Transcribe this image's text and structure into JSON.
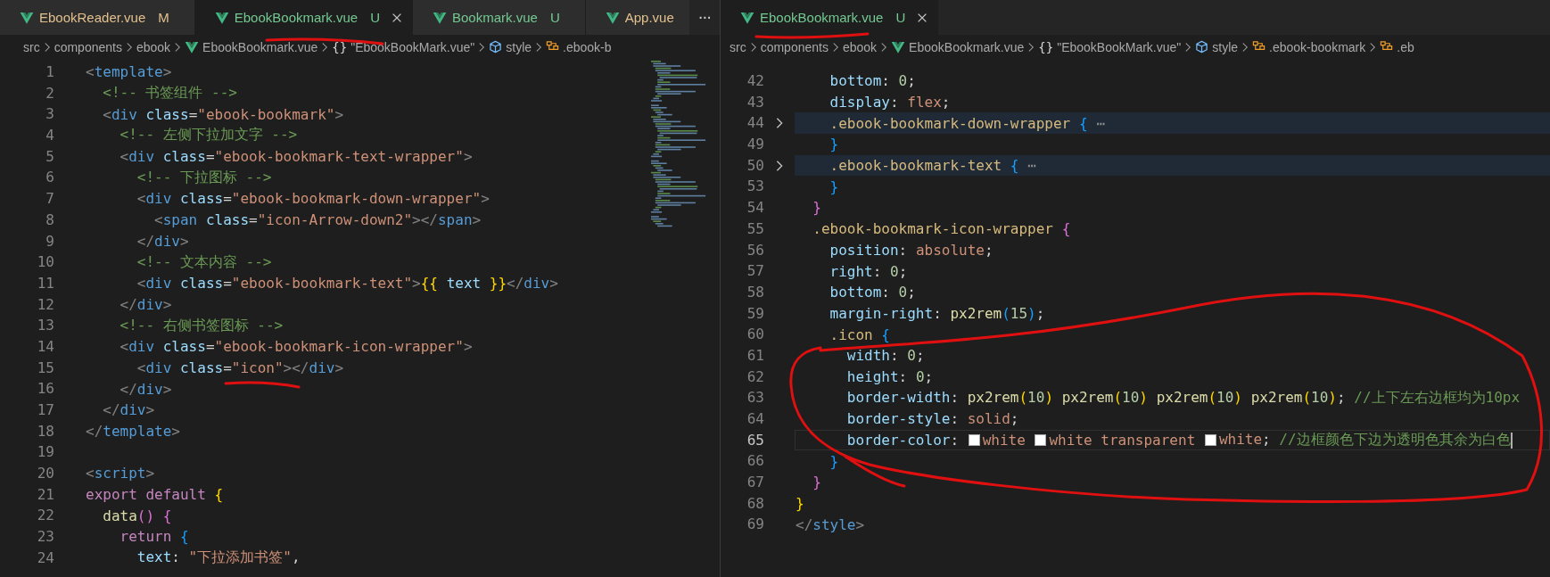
{
  "left_pane": {
    "tabs": [
      {
        "label": "EbookReader.vue",
        "badge": "M",
        "color": "#e2c08d",
        "selected": false
      },
      {
        "label": "EbookBookmark.vue",
        "badge": "U",
        "color": "#73c991",
        "selected": true
      },
      {
        "label": "Bookmark.vue",
        "badge": "U",
        "color": "#73c991",
        "selected": false
      },
      {
        "label": "App.vue",
        "color": "#e2c08d",
        "selected": false
      }
    ],
    "more": "···",
    "breadcrumbs": [
      {
        "kind": "folder",
        "label": "src"
      },
      {
        "kind": "folder",
        "label": "components"
      },
      {
        "kind": "folder",
        "label": "ebook"
      },
      {
        "kind": "file",
        "label": "EbookBookmark.vue"
      },
      {
        "kind": "object",
        "icon": "{}",
        "label": "\"EbookBookMark.vue\""
      },
      {
        "kind": "style",
        "label": "style"
      },
      {
        "kind": "selector",
        "label": ".ebook-b"
      }
    ],
    "lines": [
      {
        "number": "1",
        "text": "<template>"
      },
      {
        "number": "2",
        "text": "  <!-- 书签组件 -->"
      },
      {
        "number": "3",
        "text": "  <div class=\"ebook-bookmark\">"
      },
      {
        "number": "4",
        "text": "    <!-- 左侧下拉加文字 -->"
      },
      {
        "number": "5",
        "text": "    <div class=\"ebook-bookmark-text-wrapper\">"
      },
      {
        "number": "6",
        "text": "      <!-- 下拉图标 -->"
      },
      {
        "number": "7",
        "text": "      <div class=\"ebook-bookmark-down-wrapper\">"
      },
      {
        "number": "8",
        "text": "        <span class=\"icon-Arrow-down2\"></span>"
      },
      {
        "number": "9",
        "text": "      </div>"
      },
      {
        "number": "10",
        "text": "      <!-- 文本内容 -->"
      },
      {
        "number": "11",
        "text": "      <div class=\"ebook-bookmark-text\">{{ text }}</div>"
      },
      {
        "number": "12",
        "text": "    </div>"
      },
      {
        "number": "13",
        "text": "    <!-- 右侧书签图标 -->"
      },
      {
        "number": "14",
        "text": "    <div class=\"ebook-bookmark-icon-wrapper\">"
      },
      {
        "number": "15",
        "text": "      <div class=\"icon\"></div>"
      },
      {
        "number": "16",
        "text": "    </div>"
      },
      {
        "number": "17",
        "text": "  </div>"
      },
      {
        "number": "18",
        "text": "</template>"
      },
      {
        "number": "19"
      },
      {
        "number": "20",
        "text": "<script>"
      },
      {
        "number": "21",
        "text": "export default {"
      },
      {
        "number": "22",
        "text": "  data() {"
      },
      {
        "number": "23",
        "text": "    return {"
      },
      {
        "number": "24",
        "text": "      text: \"下拉添加书签\","
      }
    ]
  },
  "right_pane": {
    "tabs": [
      {
        "label": "EbookBookmark.vue",
        "badge": "U",
        "color": "#73c991",
        "selected": true
      }
    ],
    "breadcrumbs": [
      {
        "kind": "folder",
        "label": "src"
      },
      {
        "kind": "folder",
        "label": "components"
      },
      {
        "kind": "folder",
        "label": "ebook"
      },
      {
        "kind": "file",
        "label": "EbookBookmark.vue"
      },
      {
        "kind": "object",
        "icon": "{}",
        "label": "\"EbookBookMark.vue\""
      },
      {
        "kind": "style",
        "label": "style"
      },
      {
        "kind": "selector",
        "label": ".ebook-bookmark"
      },
      {
        "kind": "selector",
        "label": ".eb"
      }
    ],
    "lines": [
      {
        "number": "42",
        "text": "    bottom: 0;",
        "folded": false,
        "current": false
      },
      {
        "number": "43",
        "text": "    display: flex;",
        "folded": false,
        "current": false
      },
      {
        "number": "44",
        "text": "    .ebook-bookmark-down-wrapper { ⋯",
        "folded": true,
        "current": false
      },
      {
        "number": "49",
        "text": "    }",
        "folded": false,
        "current": false
      },
      {
        "number": "50",
        "text": "    .ebook-bookmark-text { ⋯",
        "folded": true,
        "current": false
      },
      {
        "number": "53",
        "text": "    }",
        "folded": false,
        "current": false
      },
      {
        "number": "54",
        "text": "  }",
        "folded": false,
        "current": false
      },
      {
        "number": "55",
        "text": "  .ebook-bookmark-icon-wrapper {",
        "folded": false,
        "current": false
      },
      {
        "number": "56",
        "text": "    position: absolute;",
        "folded": false,
        "current": false
      },
      {
        "number": "57",
        "text": "    right: 0;",
        "folded": false,
        "current": false
      },
      {
        "number": "58",
        "text": "    bottom: 0;",
        "folded": false,
        "current": false
      },
      {
        "number": "59",
        "text": "    margin-right: px2rem(15);",
        "folded": false,
        "current": false
      },
      {
        "number": "60",
        "text": "    .icon {",
        "folded": false,
        "current": false
      },
      {
        "number": "61",
        "text": "      width: 0;",
        "folded": false,
        "current": false
      },
      {
        "number": "62",
        "text": "      height: 0;",
        "folded": false,
        "current": false
      },
      {
        "number": "63",
        "text": "      border-width: px2rem(10) px2rem(10) px2rem(10) px2rem(10); //上下左右边框均为10px",
        "folded": false,
        "current": false
      },
      {
        "number": "64",
        "text": "      border-style: solid;",
        "folded": false,
        "current": false
      },
      {
        "number": "65",
        "tokens": [
          {
            "text": "      border-color: "
          },
          {
            "text": "white ",
            "color": "#ffffff"
          },
          {
            "text": "white transparent ",
            "color": "#ffffff"
          },
          {
            "text": "white; //边框颜色下边为透明色其余为白色",
            "color": "#ffffff"
          }
        ],
        "folded": false,
        "current": true
      },
      {
        "number": "66",
        "text": "    }",
        "folded": false,
        "current": false
      },
      {
        "number": "67",
        "text": "  }",
        "folded": false,
        "current": false
      },
      {
        "number": "68",
        "text": "}",
        "folded": false,
        "current": false
      },
      {
        "number": "69",
        "text": "</style>",
        "folded": false,
        "current": false
      }
    ]
  }
}
